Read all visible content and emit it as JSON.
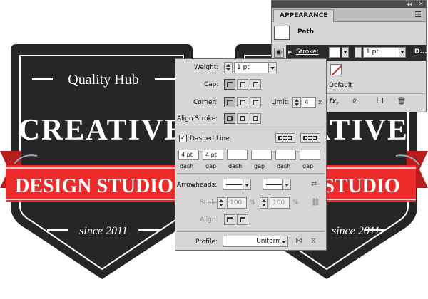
{
  "artwork": {
    "colors": {
      "badge": "#262626",
      "ribbon": "#ee2b2b",
      "ribbon_dark": "#b81d1d",
      "ink": "#ffffff"
    },
    "left_badge": {
      "top": "Quality Hub",
      "main": "CREATIVE",
      "ribbon": "DESIGN STUDIO",
      "bottom": "since 2011"
    },
    "right_badge": {
      "main": "ATIVE",
      "ribbon": "STUDIO",
      "bottom": "since 2011"
    }
  },
  "appearance": {
    "tab": "APPEARANCE",
    "collapse_icon": "double-arrow-left-icon",
    "close_icon": "close-icon",
    "menu_icon": "panel-menu-icon",
    "object_label": "Path",
    "stroke": {
      "label": "Stroke:",
      "weight": "1 pt",
      "trailing": "D..."
    },
    "fill_default": "Default",
    "toolbar_icons": [
      "fx-icon",
      "clear-icon",
      "duplicate-icon",
      "delete-icon"
    ],
    "fx_label": "fx,"
  },
  "stroke_panel": {
    "weight": {
      "label": "Weight:",
      "value": "1 pt"
    },
    "cap_label": "Cap:",
    "corner_label": "Corner:",
    "limit": {
      "label": "Limit:",
      "value": "4",
      "unit": "x"
    },
    "align_label": "Align Stroke:",
    "dashed_line": {
      "label": "Dashed Line",
      "checked": true
    },
    "dash_values": [
      "4 pt",
      "4 pt",
      "",
      "",
      "",
      ""
    ],
    "dash_labels": [
      "dash",
      "gap",
      "dash",
      "gap",
      "dash",
      "gap"
    ],
    "arrowheads_label": "Arrowheads:",
    "scale": {
      "label": "Scale:",
      "start": "100",
      "end": "100",
      "unit": "%"
    },
    "align_arrow_label": "Align:",
    "profile": {
      "label": "Profile:",
      "value": "Uniform"
    }
  }
}
